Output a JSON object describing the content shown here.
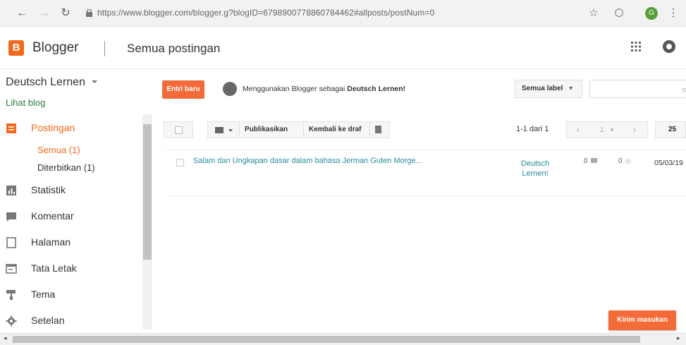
{
  "browser": {
    "url": "https://www.blogger.com/blogger.g?blogID=6798900778860784462#allposts/postNum=0",
    "profile_initial": "G"
  },
  "header": {
    "brand": "Blogger",
    "logo_letter": "B",
    "page_title": "Semua postingan",
    "accent_color": "#f2691e"
  },
  "sidebar": {
    "blog_name": "Deutsch Lernen",
    "view_blog": "Lihat blog",
    "items": [
      {
        "label": "Postingan",
        "icon": "posts-icon",
        "active": true
      },
      {
        "label": "Statistik",
        "icon": "stats-icon"
      },
      {
        "label": "Komentar",
        "icon": "comments-icon"
      },
      {
        "label": "Halaman",
        "icon": "pages-icon"
      },
      {
        "label": "Tata Letak",
        "icon": "layout-icon"
      },
      {
        "label": "Tema",
        "icon": "theme-icon"
      },
      {
        "label": "Setelan",
        "icon": "settings-icon"
      }
    ],
    "sub_items": [
      {
        "label": "Semua (1)",
        "active": true
      },
      {
        "label": "Diterbitkan (1)"
      }
    ]
  },
  "main": {
    "new_post": "Entri baru",
    "using_as_prefix": "Menggunakan Blogger sebagai ",
    "using_as_blog": "Deutsch Lernen!",
    "label_filter": "Semua label",
    "toolbar": {
      "publish": "Publikasikan",
      "revert": "Kembali ke draf"
    },
    "pager": {
      "range": "1-1 dari 1",
      "page": "1",
      "per_page": "25"
    },
    "posts": [
      {
        "title": "Salam dan Ungkapan dasar dalam bahasa Jerman Guten Morge...",
        "author_line1": "Deutsch",
        "author_line2": "Lernen!",
        "comments": "0",
        "views": "0",
        "date": "05/03/19"
      }
    ],
    "feedback": "Kirim masukan"
  }
}
